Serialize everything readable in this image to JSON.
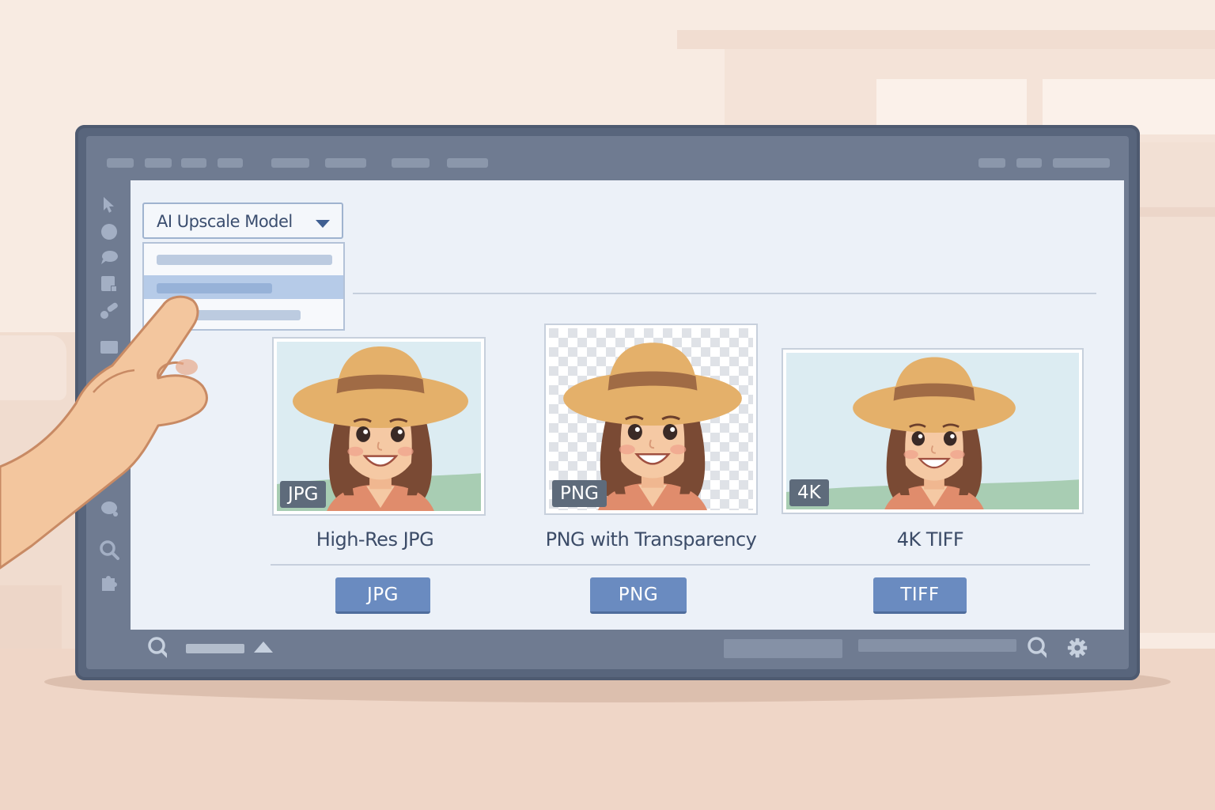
{
  "dropdown": {
    "label": "AI Upscale Model",
    "caret_icon": "chevron-down-icon"
  },
  "outputs": [
    {
      "badge": "JPG",
      "caption": "High-Res JPG",
      "button": "JPG"
    },
    {
      "badge": "PNG",
      "caption": "PNG with Transparency",
      "button": "PNG"
    },
    {
      "badge": "4K",
      "caption": "4K TIFF",
      "button": "TIFF"
    }
  ],
  "tools": [
    "pointer-icon",
    "circle-icon",
    "speech-bubble-icon",
    "layer-icon",
    "brush-icon",
    "rectangle-icon",
    "chat-icon",
    "zoom-icon",
    "puzzle-icon"
  ],
  "bottom_bar": {
    "icons": [
      "search-icon",
      "triangle-up-icon",
      "search-icon",
      "gear-icon"
    ]
  },
  "colors": {
    "accent_button": "#6a8bc0",
    "monitor_frame": "#58657c",
    "screen_bg": "#ecf1f8"
  }
}
